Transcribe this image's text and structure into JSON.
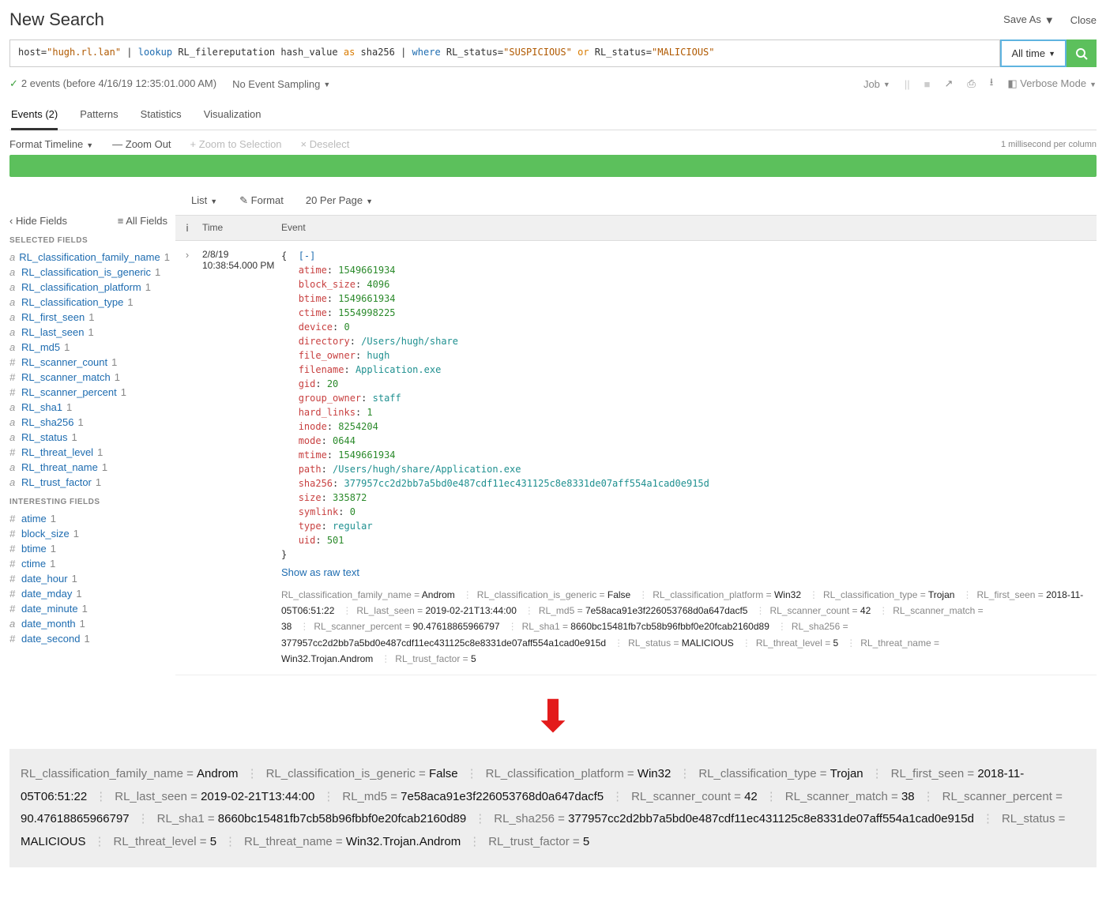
{
  "header": {
    "title": "New Search",
    "saveAs": "Save As",
    "close": "Close"
  },
  "search": {
    "timeRange": "All time",
    "query_parts": {
      "p1": "host=",
      "p2": "\"hugh.rl.lan\"",
      "p3": " | ",
      "p4": "lookup",
      "p5": " RL_filereputation hash_value ",
      "p6": "as",
      "p7": " sha256 | ",
      "p8": "where",
      "p9": " RL_status=",
      "p10": "\"SUSPICIOUS\"",
      "p11": " ",
      "p12": "or",
      "p13": " RL_status=",
      "p14": "\"MALICIOUS\""
    }
  },
  "status": {
    "eventsText": "2 events (before 4/16/19 12:35:01.000 AM)",
    "sampling": "No Event Sampling",
    "job": "Job",
    "verbose": "Verbose Mode"
  },
  "tabs": {
    "events": "Events (2)",
    "patterns": "Patterns",
    "statistics": "Statistics",
    "visualization": "Visualization"
  },
  "timeline": {
    "format": "Format Timeline",
    "zoomOut": "Zoom Out",
    "zoomSel": "Zoom to Selection",
    "deselect": "Deselect",
    "scale": "1 millisecond per column"
  },
  "midCtrls": {
    "list": "List",
    "format": "Format",
    "perPage": "20 Per Page"
  },
  "sidebar": {
    "hide": "Hide Fields",
    "all": "All Fields",
    "selectedHeading": "SELECTED FIELDS",
    "interestingHeading": "INTERESTING FIELDS",
    "selected": [
      {
        "t": "a",
        "n": "RL_classification_family_name",
        "c": "1"
      },
      {
        "t": "a",
        "n": "RL_classification_is_generic",
        "c": "1"
      },
      {
        "t": "a",
        "n": "RL_classification_platform",
        "c": "1"
      },
      {
        "t": "a",
        "n": "RL_classification_type",
        "c": "1"
      },
      {
        "t": "a",
        "n": "RL_first_seen",
        "c": "1"
      },
      {
        "t": "a",
        "n": "RL_last_seen",
        "c": "1"
      },
      {
        "t": "a",
        "n": "RL_md5",
        "c": "1"
      },
      {
        "t": "#",
        "n": "RL_scanner_count",
        "c": "1"
      },
      {
        "t": "#",
        "n": "RL_scanner_match",
        "c": "1"
      },
      {
        "t": "#",
        "n": "RL_scanner_percent",
        "c": "1"
      },
      {
        "t": "a",
        "n": "RL_sha1",
        "c": "1"
      },
      {
        "t": "a",
        "n": "RL_sha256",
        "c": "1"
      },
      {
        "t": "a",
        "n": "RL_status",
        "c": "1"
      },
      {
        "t": "#",
        "n": "RL_threat_level",
        "c": "1"
      },
      {
        "t": "a",
        "n": "RL_threat_name",
        "c": "1"
      },
      {
        "t": "a",
        "n": "RL_trust_factor",
        "c": "1"
      }
    ],
    "interesting": [
      {
        "t": "#",
        "n": "atime",
        "c": "1"
      },
      {
        "t": "#",
        "n": "block_size",
        "c": "1"
      },
      {
        "t": "#",
        "n": "btime",
        "c": "1"
      },
      {
        "t": "#",
        "n": "ctime",
        "c": "1"
      },
      {
        "t": "#",
        "n": "date_hour",
        "c": "1"
      },
      {
        "t": "#",
        "n": "date_mday",
        "c": "1"
      },
      {
        "t": "#",
        "n": "date_minute",
        "c": "1"
      },
      {
        "t": "a",
        "n": "date_month",
        "c": "1"
      },
      {
        "t": "#",
        "n": "date_second",
        "c": "1"
      }
    ]
  },
  "tableHeader": {
    "info": "i",
    "time": "Time",
    "event": "Event"
  },
  "event": {
    "date": "2/8/19",
    "time": "10:38:54.000 PM",
    "open": "{  ",
    "collapse": "[-]",
    "close": "}",
    "showRaw": "Show as raw text",
    "fields": [
      {
        "k": "atime",
        "v": "1549661934",
        "num": true
      },
      {
        "k": "block_size",
        "v": "4096",
        "num": true
      },
      {
        "k": "btime",
        "v": "1549661934",
        "num": true
      },
      {
        "k": "ctime",
        "v": "1554998225",
        "num": true
      },
      {
        "k": "device",
        "v": "0",
        "num": true
      },
      {
        "k": "directory",
        "v": "/Users/hugh/share",
        "num": false
      },
      {
        "k": "file_owner",
        "v": "hugh",
        "num": false
      },
      {
        "k": "filename",
        "v": "Application.exe",
        "num": false
      },
      {
        "k": "gid",
        "v": "20",
        "num": true
      },
      {
        "k": "group_owner",
        "v": "staff",
        "num": false
      },
      {
        "k": "hard_links",
        "v": "1",
        "num": true
      },
      {
        "k": "inode",
        "v": "8254204",
        "num": true
      },
      {
        "k": "mode",
        "v": "0644",
        "num": true
      },
      {
        "k": "mtime",
        "v": "1549661934",
        "num": true
      },
      {
        "k": "path",
        "v": "/Users/hugh/share/Application.exe",
        "num": false
      },
      {
        "k": "sha256",
        "v": "377957cc2d2bb7a5bd0e487cdf11ec431125c8e8331de07aff554a1cad0e915d",
        "num": false
      },
      {
        "k": "size",
        "v": "335872",
        "num": true
      },
      {
        "k": "symlink",
        "v": "0",
        "num": true
      },
      {
        "k": "type",
        "v": "regular",
        "num": false
      },
      {
        "k": "uid",
        "v": "501",
        "num": true
      }
    ],
    "tags": [
      {
        "n": "RL_classification_family_name",
        "v": "Androm"
      },
      {
        "n": "RL_classification_is_generic",
        "v": "False"
      },
      {
        "n": "RL_classification_platform",
        "v": "Win32"
      },
      {
        "n": "RL_classification_type",
        "v": "Trojan"
      },
      {
        "n": "RL_first_seen",
        "v": "2018-11-05T06:51:22"
      },
      {
        "n": "RL_last_seen",
        "v": "2019-02-21T13:44:00"
      },
      {
        "n": "RL_md5",
        "v": "7e58aca91e3f226053768d0a647dacf5"
      },
      {
        "n": "RL_scanner_count",
        "v": "42"
      },
      {
        "n": "RL_scanner_match",
        "v": "38"
      },
      {
        "n": "RL_scanner_percent",
        "v": "90.47618865966797"
      },
      {
        "n": "RL_sha1",
        "v": "8660bc15481fb7cb58b96fbbf0e20fcab2160d89"
      },
      {
        "n": "RL_sha256",
        "v": "377957cc2d2bb7a5bd0e487cdf11ec431125c8e8331de07aff554a1cad0e915d"
      },
      {
        "n": "RL_status",
        "v": "MALICIOUS"
      },
      {
        "n": "RL_threat_level",
        "v": "5"
      },
      {
        "n": "RL_threat_name",
        "v": "Win32.Trojan.Androm"
      },
      {
        "n": "RL_trust_factor",
        "v": "5"
      }
    ]
  },
  "zoom": [
    {
      "n": "RL_classification_family_name",
      "v": "Androm"
    },
    {
      "n": "RL_classification_is_generic",
      "v": "False"
    },
    {
      "n": "RL_classification_platform",
      "v": "Win32"
    },
    {
      "n": "RL_classification_type",
      "v": "Trojan"
    },
    {
      "n": "RL_first_seen",
      "v": "2018-11-05T06:51:22"
    },
    {
      "n": "RL_last_seen",
      "v": "2019-02-21T13:44:00"
    },
    {
      "n": "RL_md5",
      "v": "7e58aca91e3f226053768d0a647dacf5"
    },
    {
      "n": "RL_scanner_count",
      "v": "42"
    },
    {
      "n": "RL_scanner_match",
      "v": "38"
    },
    {
      "n": "RL_scanner_percent",
      "v": "90.47618865966797"
    },
    {
      "n": "RL_sha1",
      "v": "8660bc15481fb7cb58b96fbbf0e20fcab2160d89"
    },
    {
      "n": "RL_sha256",
      "v": "377957cc2d2bb7a5bd0e487cdf11ec431125c8e8331de07aff554a1cad0e915d"
    },
    {
      "n": "RL_status",
      "v": "MALICIOUS"
    },
    {
      "n": "RL_threat_level",
      "v": "5"
    },
    {
      "n": "RL_threat_name",
      "v": "Win32.Trojan.Androm"
    },
    {
      "n": "RL_trust_factor",
      "v": "5"
    }
  ]
}
